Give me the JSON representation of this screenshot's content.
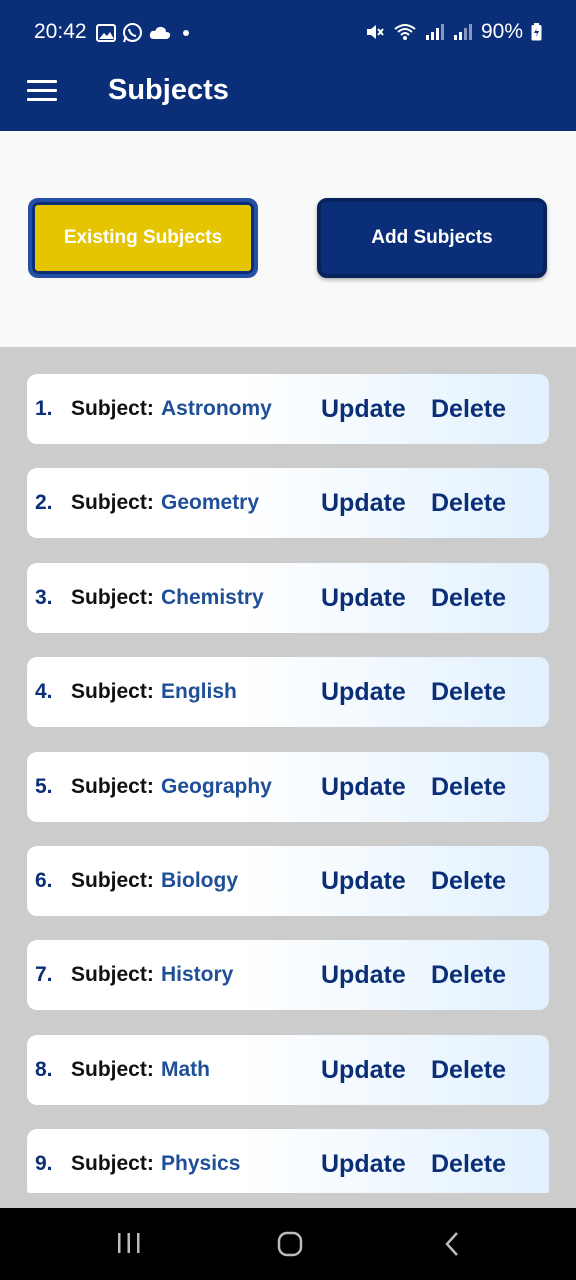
{
  "status": {
    "time": "20:42",
    "battery": "90%"
  },
  "appbar": {
    "title": "Subjects"
  },
  "tabs": {
    "existing_label": "Existing Subjects",
    "add_label": "Add Subjects"
  },
  "list": {
    "field_label": "Subject:",
    "update_label": "Update",
    "delete_label": "Delete",
    "items": [
      {
        "index": "1.",
        "name": "Astronomy"
      },
      {
        "index": "2.",
        "name": "Geometry"
      },
      {
        "index": "3.",
        "name": "Chemistry"
      },
      {
        "index": "4.",
        "name": "English"
      },
      {
        "index": "5.",
        "name": "Geography"
      },
      {
        "index": "6.",
        "name": "Biology"
      },
      {
        "index": "7.",
        "name": "History"
      },
      {
        "index": "8.",
        "name": "Math"
      },
      {
        "index": "9.",
        "name": "Physics"
      }
    ]
  },
  "colors": {
    "primary": "#0a2f78",
    "accent": "#e5c400",
    "list_bg": "#cccccc"
  }
}
